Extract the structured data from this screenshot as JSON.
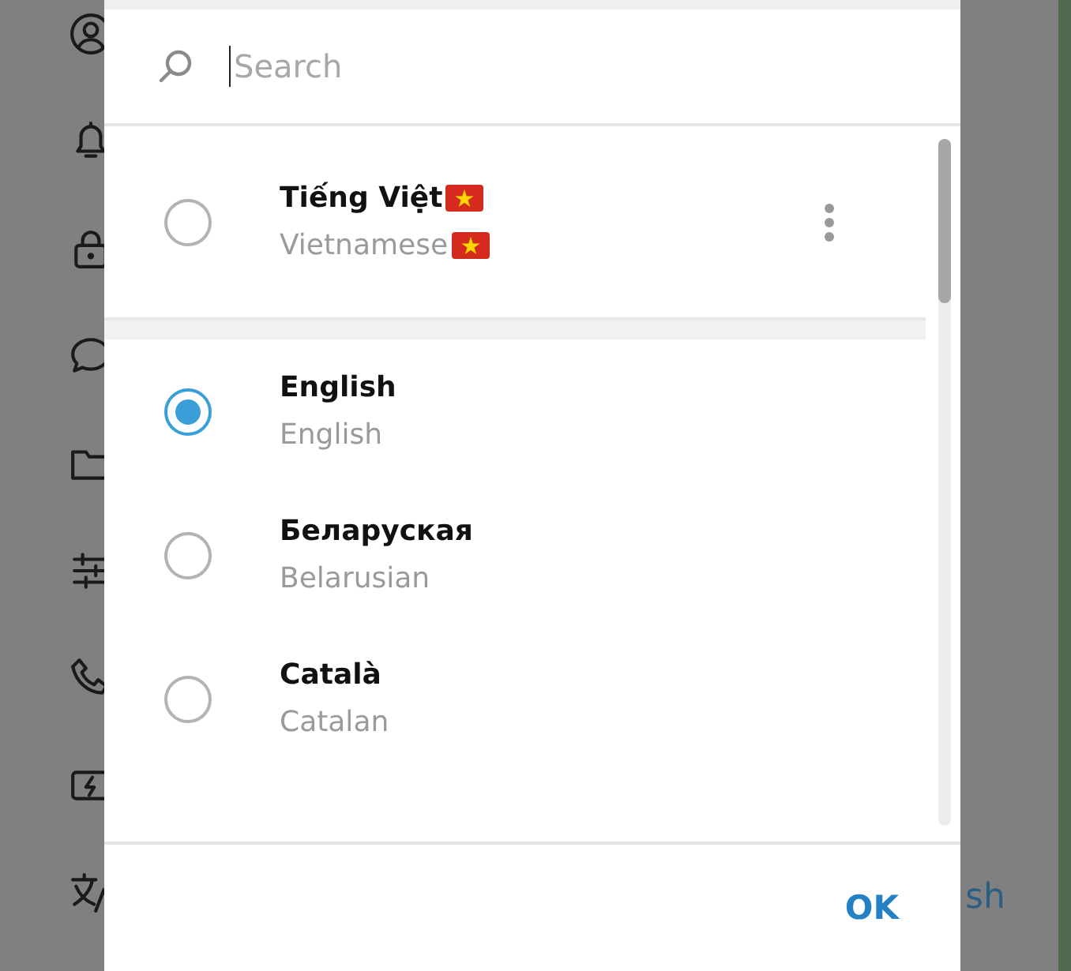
{
  "search": {
    "placeholder": "Search"
  },
  "pinned_language": {
    "name": "Tiếng Việt",
    "native_flag": true,
    "subtitle": "Vietnamese",
    "subtitle_flag": true,
    "selected": false
  },
  "languages": [
    {
      "name": "English",
      "subtitle": "English",
      "selected": true
    },
    {
      "name": "Беларуская",
      "subtitle": "Belarusian",
      "selected": false
    },
    {
      "name": "Català",
      "subtitle": "Catalan",
      "selected": false
    }
  ],
  "buttons": [
    "OK"
  ],
  "background_text": "sh"
}
